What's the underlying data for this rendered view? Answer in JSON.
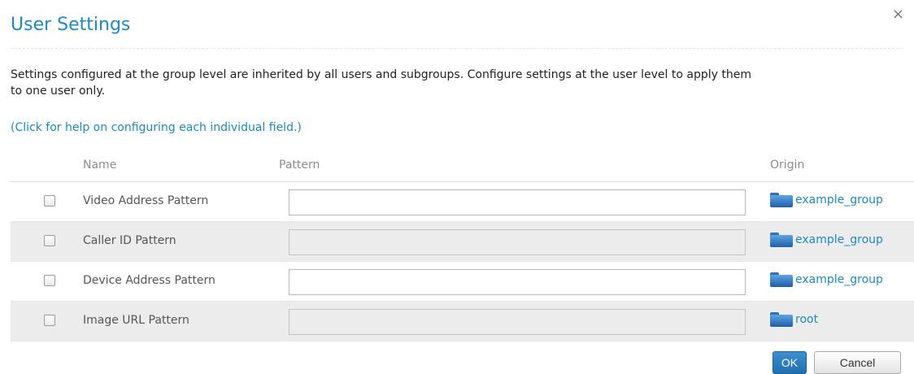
{
  "dialog": {
    "title": "User Settings",
    "close_icon": "×",
    "description": "Settings configured at the group level are inherited by all users and subgroups. Configure settings at the user level to apply them to one user only.",
    "help_link": "(Click for help on configuring each individual field.)"
  },
  "table": {
    "headers": {
      "name": "Name",
      "pattern": "Pattern",
      "origin": "Origin"
    },
    "rows": [
      {
        "name": "Video Address Pattern",
        "value": "",
        "enabled": true,
        "origin": "example_group",
        "origin_icon": "folder-icon"
      },
      {
        "name": "Caller ID Pattern",
        "value": "",
        "enabled": false,
        "origin": "example_group",
        "origin_icon": "folder-icon"
      },
      {
        "name": "Device Address Pattern",
        "value": "",
        "enabled": true,
        "origin": "example_group",
        "origin_icon": "folder-icon"
      },
      {
        "name": "Image URL Pattern",
        "value": "",
        "enabled": false,
        "origin": "root",
        "origin_icon": "folder-icon"
      }
    ]
  },
  "buttons": {
    "ok": "OK",
    "cancel": "Cancel"
  },
  "colors": {
    "accent": "#1f88c2",
    "row_alt": "#ececec",
    "ok_button": "#2a7abf"
  }
}
